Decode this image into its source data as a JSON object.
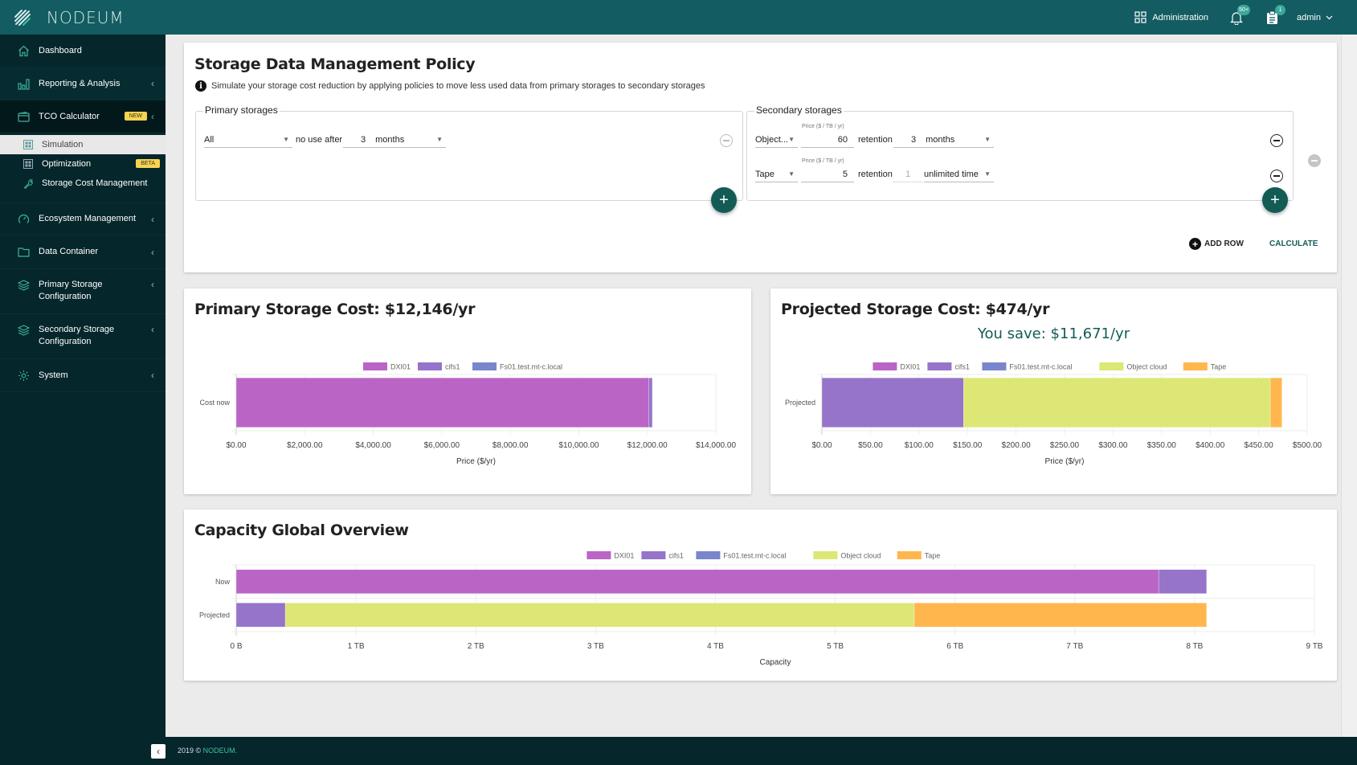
{
  "header": {
    "brand": "NODEUM",
    "administration_label": "Administration",
    "notifications_badge": "50+",
    "tasks_badge": "1",
    "user_label": "admin"
  },
  "sidebar": {
    "items": [
      {
        "label": "Dashboard",
        "icon": "home-icon"
      },
      {
        "label": "Reporting & Analysis",
        "icon": "bar-chart-icon"
      },
      {
        "label": "TCO Calculator",
        "icon": "wallet-icon",
        "tag": "NEW"
      },
      {
        "label": "Ecosystem Management",
        "icon": "gauge-icon"
      },
      {
        "label": "Data Container",
        "icon": "folder-icon"
      },
      {
        "label": "Primary Storage Configuration",
        "icon": "layers-icon"
      },
      {
        "label": "Secondary Storage Configuration",
        "icon": "layers-icon"
      },
      {
        "label": "System",
        "icon": "gear-icon"
      }
    ],
    "tco_subitems": [
      {
        "label": "Simulation",
        "icon": "grid-icon",
        "active": true
      },
      {
        "label": "Optimization",
        "icon": "grid-icon",
        "tag": "BETA"
      },
      {
        "label": "Storage Cost Management",
        "icon": "wrench-icon"
      }
    ]
  },
  "policy": {
    "title": "Storage Data Management Policy",
    "info": "Simulate your storage cost reduction by applying policies to move less used data from primary storages to secondary storages",
    "primary": {
      "legend": "Primary storages",
      "rows": [
        {
          "storage": "All",
          "connector": "no use after",
          "amount": "3",
          "unit": "months"
        }
      ]
    },
    "secondary": {
      "legend": "Secondary storages",
      "price_label": "Price ($ / TB / yr)",
      "retention_label": "retention",
      "rows": [
        {
          "storage": "Object...",
          "price": "60",
          "amount": "3",
          "unit": "months"
        },
        {
          "storage": "Tape",
          "price": "5",
          "amount": "1",
          "unit": "unlimited time"
        }
      ]
    },
    "add_row_label": "ADD ROW",
    "calculate_label": "CALCULATE"
  },
  "colors": {
    "DXI01": "#ba65c5",
    "cifs1": "#9574c9",
    "Fs01.test.mt-c.local": "#7986cb",
    "Object cloud": "#dce775",
    "Tape": "#ffb74d",
    "accent": "#135c55"
  },
  "footer": {
    "copyright": "2019 ©",
    "brand": "NODEUM."
  },
  "chart_data": [
    {
      "id": "primary",
      "type": "bar",
      "orientation": "horizontal",
      "stacked": true,
      "title": "Primary Storage Cost: $12,146/yr",
      "categories": [
        "Cost now"
      ],
      "legend": [
        "DXI01",
        "cifs1",
        "Fs01.test.mt-c.local"
      ],
      "series": [
        {
          "name": "DXI01",
          "values": [
            12040
          ]
        },
        {
          "name": "cifs1",
          "values": [
            106
          ]
        },
        {
          "name": "Fs01.test.mt-c.local",
          "values": [
            0
          ]
        }
      ],
      "xlabel": "Price ($/yr)",
      "ylabel": "",
      "xlim": [
        0,
        14000
      ],
      "xticks": [
        0,
        2000,
        4000,
        6000,
        8000,
        10000,
        12000,
        14000
      ],
      "xtick_labels": [
        "$0.00",
        "$2,000.00",
        "$4,000.00",
        "$6,000.00",
        "$8,000.00",
        "$10,000.00",
        "$12,000.00",
        "$14,000.00"
      ],
      "grid": true,
      "legend_position": "top"
    },
    {
      "id": "projected",
      "type": "bar",
      "orientation": "horizontal",
      "stacked": true,
      "title": "Projected Storage Cost: $474/yr",
      "subtitle": "You save: $11,671/yr",
      "categories": [
        "Projected"
      ],
      "legend": [
        "DXI01",
        "cifs1",
        "Fs01.test.mt-c.local",
        "Object cloud",
        "Tape"
      ],
      "series": [
        {
          "name": "DXI01",
          "values": [
            0
          ]
        },
        {
          "name": "cifs1",
          "values": [
            146
          ]
        },
        {
          "name": "Fs01.test.mt-c.local",
          "values": [
            0
          ]
        },
        {
          "name": "Object cloud",
          "values": [
            316
          ]
        },
        {
          "name": "Tape",
          "values": [
            12
          ]
        }
      ],
      "xlabel": "Price ($/yr)",
      "ylabel": "",
      "xlim": [
        0,
        500
      ],
      "xticks": [
        0,
        50,
        100,
        150,
        200,
        250,
        300,
        350,
        400,
        450,
        500
      ],
      "xtick_labels": [
        "$0.00",
        "$50.00",
        "$100.00",
        "$150.00",
        "$200.00",
        "$250.00",
        "$300.00",
        "$350.00",
        "$400.00",
        "$450.00",
        "$500.00"
      ],
      "grid": true,
      "legend_position": "top"
    },
    {
      "id": "capacity",
      "type": "bar",
      "orientation": "horizontal",
      "stacked": true,
      "title": "Capacity Global Overview",
      "categories": [
        "Now",
        "Projected"
      ],
      "legend": [
        "DXI01",
        "cifs1",
        "Fs01.test.mt-c.local",
        "Object cloud",
        "Tape"
      ],
      "series": [
        {
          "name": "DXI01",
          "values": [
            7.7,
            0
          ]
        },
        {
          "name": "cifs1",
          "values": [
            0.4,
            0.41
          ]
        },
        {
          "name": "Fs01.test.mt-c.local",
          "values": [
            0,
            0
          ]
        },
        {
          "name": "Object cloud",
          "values": [
            0,
            5.25
          ]
        },
        {
          "name": "Tape",
          "values": [
            0,
            2.44
          ]
        }
      ],
      "xlabel": "Capacity",
      "ylabel": "",
      "xlim": [
        0,
        9
      ],
      "xticks": [
        0,
        1,
        2,
        3,
        4,
        5,
        6,
        7,
        8,
        9
      ],
      "xtick_labels": [
        "0 B",
        "1 TB",
        "2 TB",
        "3 TB",
        "4 TB",
        "5 TB",
        "6 TB",
        "7 TB",
        "8 TB",
        "9 TB"
      ],
      "units": "TB",
      "grid": true,
      "legend_position": "top"
    }
  ]
}
